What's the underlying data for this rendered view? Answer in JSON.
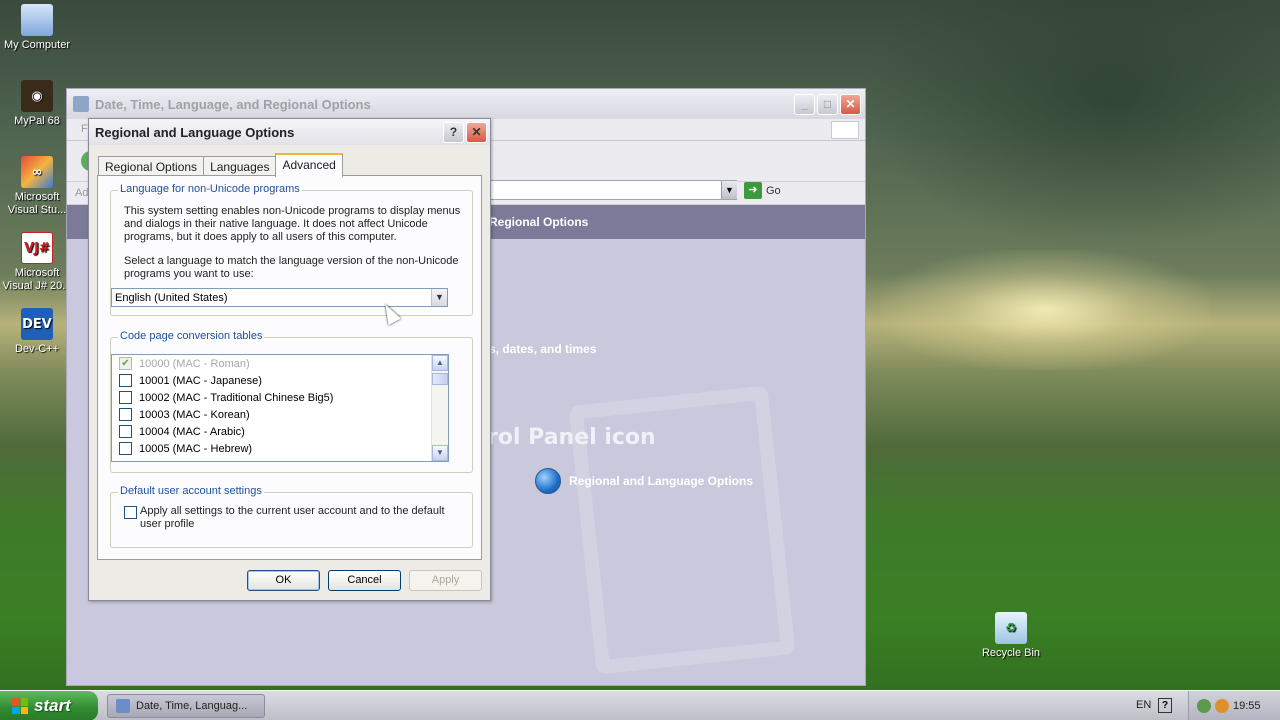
{
  "desktop": {
    "icons": [
      {
        "label": "My Computer"
      },
      {
        "label": "MyPal 68"
      },
      {
        "label": "Microsoft Visual Stu..."
      },
      {
        "label": "Microsoft Visual J# 20..."
      },
      {
        "label": "Dev-C++"
      },
      {
        "label": "Recycle Bin"
      }
    ]
  },
  "control_panel": {
    "title": "Date, Time, Language, and Regional Options",
    "menu_first": "Fi",
    "address_label": "Ad",
    "go_label": "Go",
    "banner_text": "Regional Options",
    "subtitle_text": "s, dates, and times",
    "big_text": "rol Panel icon",
    "link_text": "Regional and Language Options"
  },
  "dialog": {
    "title": "Regional and Language Options",
    "help_glyph": "?",
    "close_glyph": "✕",
    "tabs": [
      {
        "label": "Regional Options"
      },
      {
        "label": "Languages"
      },
      {
        "label": "Advanced"
      }
    ],
    "non_unicode": {
      "group_label": "Language for non-Unicode programs",
      "description": "This system setting enables non-Unicode programs to display menus and dialogs in their native language. It does not affect Unicode programs, but it does apply to all users of this computer.",
      "prompt": "Select a language to match the language version of the non-Unicode programs you want to use:",
      "selected_language": "English (United States)"
    },
    "code_pages": {
      "group_label": "Code page conversion tables",
      "items": [
        {
          "label": "10000 (MAC - Roman)",
          "checked": true,
          "disabled": true
        },
        {
          "label": "10001 (MAC - Japanese)",
          "checked": false,
          "disabled": false
        },
        {
          "label": "10002 (MAC - Traditional Chinese Big5)",
          "checked": false,
          "disabled": false
        },
        {
          "label": "10003 (MAC - Korean)",
          "checked": false,
          "disabled": false
        },
        {
          "label": "10004 (MAC - Arabic)",
          "checked": false,
          "disabled": false
        },
        {
          "label": "10005 (MAC - Hebrew)",
          "checked": false,
          "disabled": false
        }
      ]
    },
    "default_user": {
      "group_label": "Default user account settings",
      "checkbox_label": "Apply all settings to the current user account and to the default user profile",
      "checked": false
    },
    "buttons": {
      "ok": "OK",
      "cancel": "Cancel",
      "apply": "Apply"
    }
  },
  "taskbar": {
    "start_label": "start",
    "task_label": "Date, Time, Languag...",
    "language": "EN",
    "help_glyph": "?",
    "clock": "19:55"
  }
}
